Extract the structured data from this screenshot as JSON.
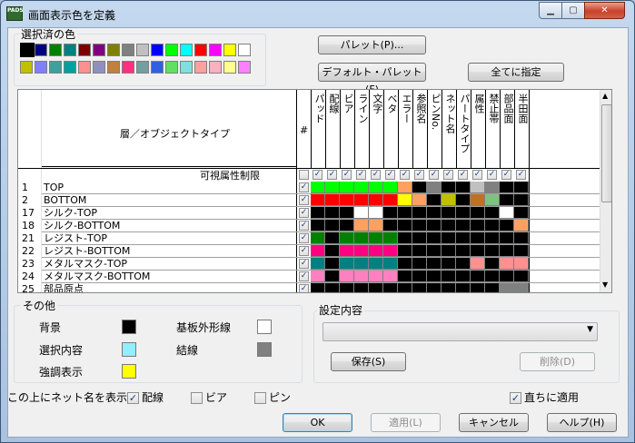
{
  "window": {
    "title": "画面表示色を定義",
    "app_icon_text": "PADS"
  },
  "selected_colors": {
    "label": "選択済の色",
    "row1": [
      "#000000",
      "#000080",
      "#008000",
      "#008080",
      "#800000",
      "#800080",
      "#808000",
      "#808080",
      "#c0c0c0",
      "#0000ff",
      "#00ff00",
      "#00ffff",
      "#ff0000",
      "#ff00ff",
      "#ffff00",
      "#ffffff"
    ],
    "row2": [
      "#c0c000",
      "#8080ff",
      "#40a0a0",
      "#00a0a0",
      "#ff9090",
      "#9090c0",
      "#c08040",
      "#ff3080",
      "#70a0a0",
      "#3060e0",
      "#60e060",
      "#80e0e0",
      "#ffa0a0",
      "#ffb0c0",
      "#ffff90",
      "#ff80ff"
    ]
  },
  "buttons": {
    "palette": "パレット(P)...",
    "default_palette": "デフォルト・パレット(F)",
    "assign_all": "全てに指定",
    "save": "保存(S)",
    "delete": "削除(D)",
    "ok": "OK",
    "apply": "適用(L)",
    "cancel": "キャンセル",
    "help": "ヘルプ(H)"
  },
  "grid": {
    "header_title": "層／オブジェクトタイプ",
    "hash_label": "#",
    "columns": [
      "パッド",
      "配線",
      "ビア",
      "ライン",
      "文字",
      "ベタ",
      "エラー",
      "参照名",
      "ピンNo.",
      "ネット名",
      "パートタイプ",
      "属性",
      "禁止帯",
      "部品面",
      "半田面"
    ],
    "visibility_label": "可視属性制限",
    "rows": [
      {
        "num": "1",
        "name": "TOP",
        "checked": true,
        "colors": [
          "#00ff00",
          "#00ff00",
          "#00ff00",
          "#00ff00",
          "#00ff00",
          "#00ff00",
          "#ffa060",
          "#000000",
          "#808080",
          "#000000",
          "#000000",
          "#c0c0c0",
          "#808080",
          "#000000",
          "#000000"
        ]
      },
      {
        "num": "2",
        "name": "BOTTOM",
        "checked": true,
        "colors": [
          "#ff0000",
          "#ff0000",
          "#ff0000",
          "#ff0000",
          "#ff0000",
          "#ff0000",
          "#ffff00",
          "#ffa060",
          "#000000",
          "#c0c000",
          "#000000",
          "#c07020",
          "#80c080",
          "#000000",
          "#000000"
        ]
      },
      {
        "num": "17",
        "name": "シルク-TOP",
        "checked": true,
        "colors": [
          "#000000",
          "#000000",
          "#000000",
          "#ffffff",
          "#ffffff",
          "#000000",
          "#000000",
          "#000000",
          "#000000",
          "#000000",
          "#000000",
          "#000000",
          "#000000",
          "#ffffff",
          "#000000"
        ]
      },
      {
        "num": "18",
        "name": "シルク-BOTTOM",
        "checked": true,
        "colors": [
          "#000000",
          "#000000",
          "#000000",
          "#ffa060",
          "#ffa060",
          "#000000",
          "#000000",
          "#000000",
          "#000000",
          "#000000",
          "#000000",
          "#000000",
          "#000000",
          "#000000",
          "#ffa060"
        ]
      },
      {
        "num": "21",
        "name": "レジスト-TOP",
        "checked": true,
        "colors": [
          "#008000",
          "#000000",
          "#008000",
          "#008000",
          "#008000",
          "#008000",
          "#000000",
          "#000000",
          "#000000",
          "#000000",
          "#000000",
          "#000000",
          "#000000",
          "#000000",
          "#000000"
        ]
      },
      {
        "num": "22",
        "name": "レジスト-BOTTOM",
        "checked": true,
        "colors": [
          "#ff0080",
          "#000000",
          "#ff0080",
          "#ff0080",
          "#ff0080",
          "#ff0080",
          "#000000",
          "#000000",
          "#000000",
          "#000000",
          "#000000",
          "#000000",
          "#000000",
          "#000000",
          "#000000"
        ]
      },
      {
        "num": "23",
        "name": "メタルマスク-TOP",
        "checked": true,
        "colors": [
          "#008080",
          "#000000",
          "#008080",
          "#008080",
          "#008080",
          "#008080",
          "#000000",
          "#000000",
          "#000000",
          "#000000",
          "#000000",
          "#ff9090",
          "#000000",
          "#ff9090",
          "#ff9090"
        ]
      },
      {
        "num": "24",
        "name": "メタルマスク-BOTTOM",
        "checked": true,
        "colors": [
          "#ff80c0",
          "#000000",
          "#ff80c0",
          "#ff80c0",
          "#ff80c0",
          "#ff80c0",
          "#000000",
          "#000000",
          "#000000",
          "#000000",
          "#000000",
          "#000000",
          "#000000",
          "#000000",
          "#000000"
        ]
      },
      {
        "num": "25",
        "name": "部品原点",
        "checked": true,
        "colors": [
          "#000000",
          "#000000",
          "#000000",
          "#000000",
          "#000000",
          "#000000",
          "#000000",
          "#000000",
          "#000000",
          "#000000",
          "#000000",
          "#000000",
          "#000000",
          "#808080",
          "#808080"
        ]
      }
    ]
  },
  "other": {
    "label": "その他",
    "items": [
      {
        "label": "背景",
        "color": "#000000"
      },
      {
        "label": "選択内容",
        "color": "#90f0ff"
      },
      {
        "label": "強調表示",
        "color": "#ffff00"
      },
      {
        "label": "基板外形線",
        "color": "#ffffff"
      },
      {
        "label": "結線",
        "color": "#808080"
      }
    ]
  },
  "settings": {
    "label": "設定内容",
    "value": ""
  },
  "net_name": {
    "label": "この上にネット名を表示:",
    "options": [
      {
        "label": "配線",
        "checked": true
      },
      {
        "label": "ビア",
        "checked": false
      },
      {
        "label": "ピン",
        "checked": false
      }
    ]
  },
  "apply_immediately": {
    "label": "直ちに適用",
    "checked": true
  }
}
